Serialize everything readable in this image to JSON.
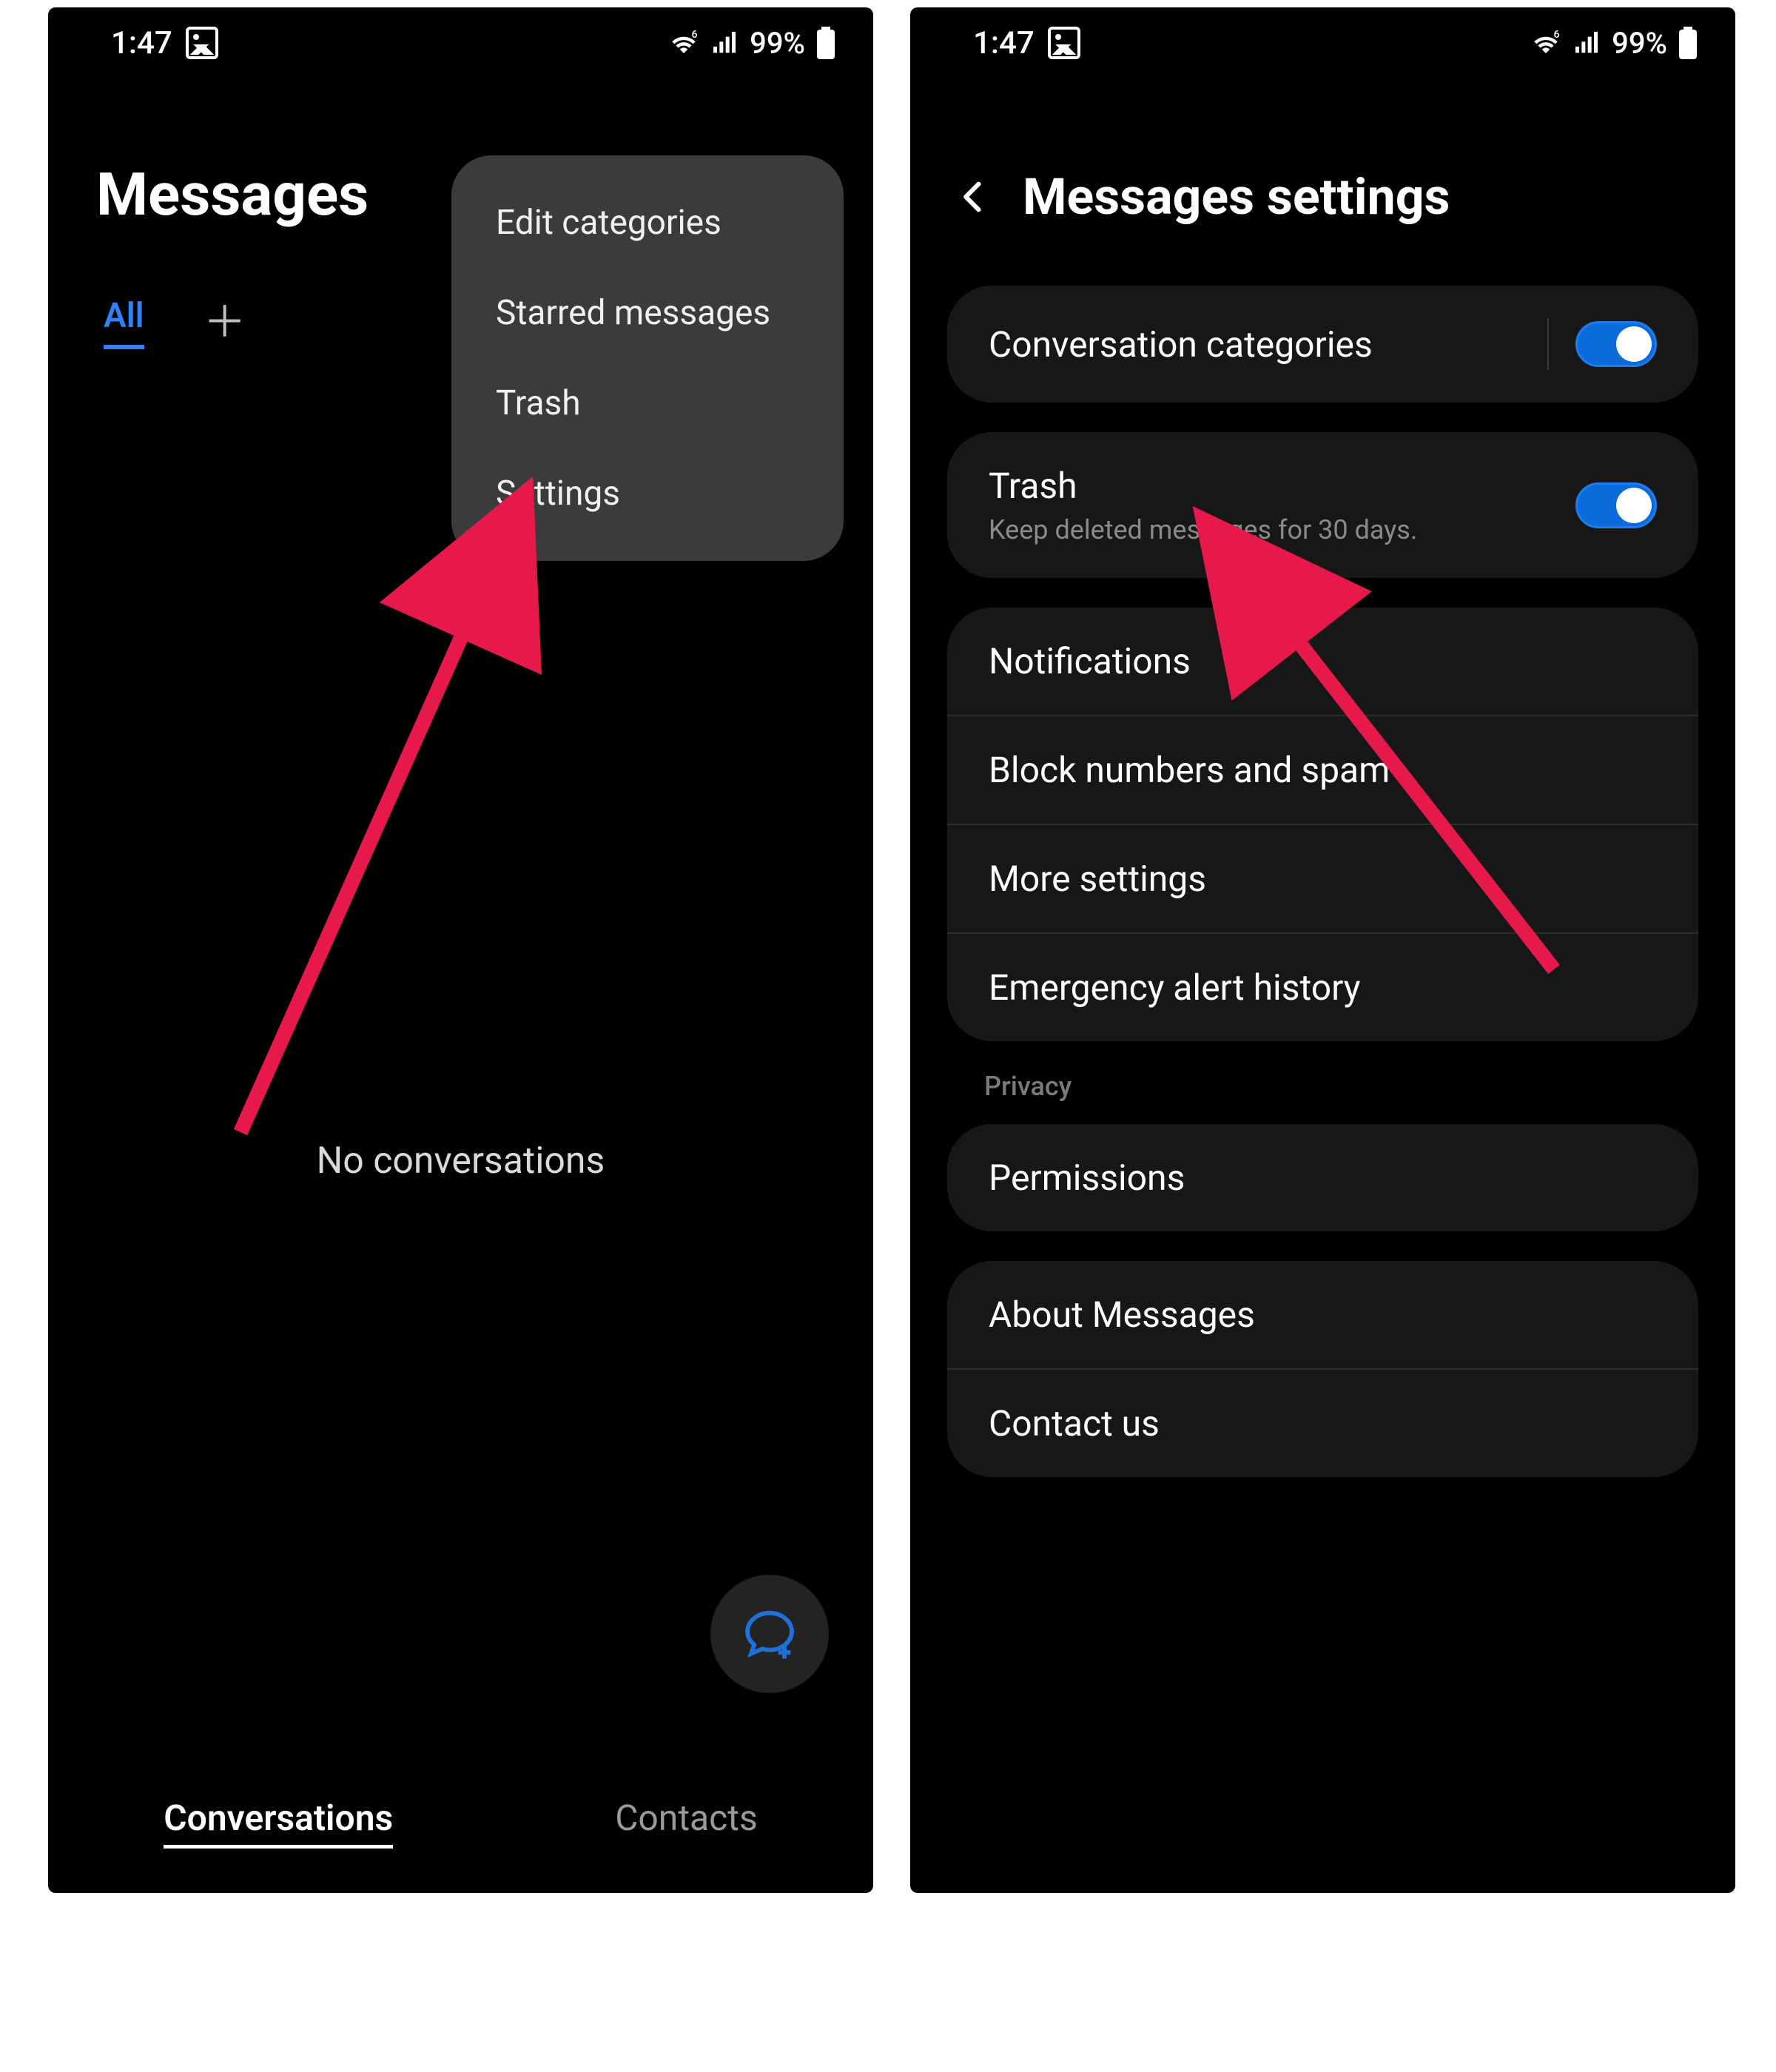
{
  "status": {
    "time": "1:47",
    "battery": "99%"
  },
  "left": {
    "title": "Messages",
    "tab_all": "All",
    "menu": {
      "edit_categories": "Edit categories",
      "starred": "Starred messages",
      "trash": "Trash",
      "settings": "Settings"
    },
    "empty": "No conversations",
    "bottom": {
      "conversations": "Conversations",
      "contacts": "Contacts"
    }
  },
  "right": {
    "title": "Messages settings",
    "conv_categories": "Conversation categories",
    "trash": {
      "title": "Trash",
      "sub": "Keep deleted messages for 30 days."
    },
    "notifications": "Notifications",
    "block": "Block numbers and spam",
    "more": "More settings",
    "emergency": "Emergency alert history",
    "privacy_label": "Privacy",
    "permissions": "Permissions",
    "about": "About Messages",
    "contact_us": "Contact us"
  }
}
